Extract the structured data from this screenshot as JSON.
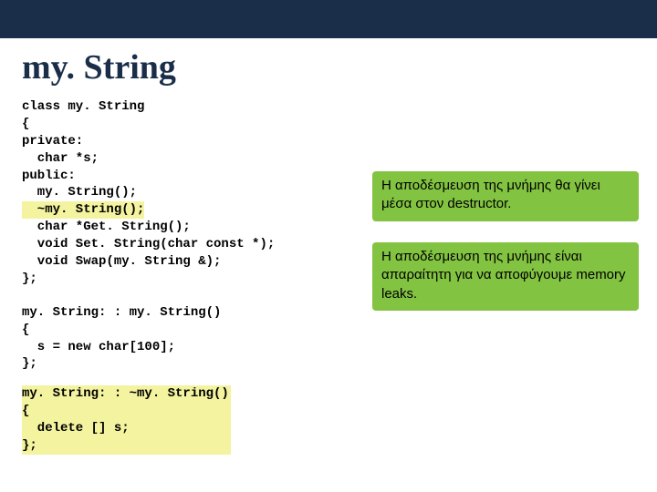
{
  "title": "my. String",
  "code_block1": "class my. String\n{\nprivate:\n  char *s;\npublic:\n  my. String();",
  "code_block1_hl": "  ~my. String();",
  "code_block1b": "  char *Get. String();\n  void Set. String(char const *);\n  void Swap(my. String &);\n};",
  "code_block2": "my. String: : my. String()\n{\n  s = new char[100];\n};",
  "code_block3": "my. String: : ~my. String()\n{\n  delete [] s;\n};",
  "note1": "Η αποδέσμευση της μνήμης θα γίνει μέσα στον destructor.",
  "note2": "Η αποδέσμευση της μνήμης είναι απαραίτητη για να αποφύγουμε memory leaks."
}
